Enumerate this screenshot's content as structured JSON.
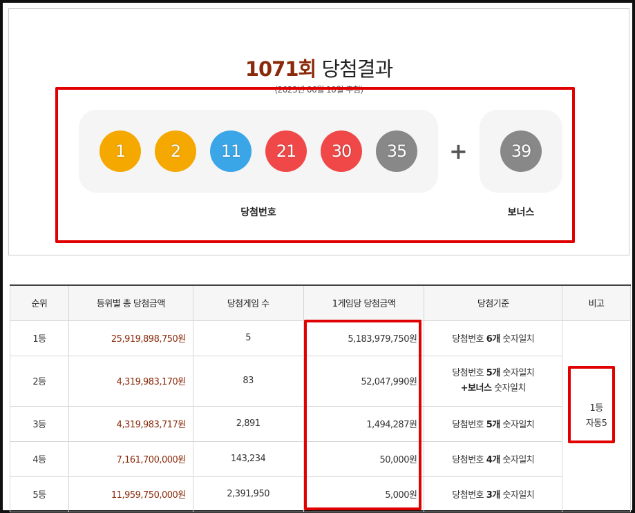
{
  "header": {
    "round": "1071회",
    "title_rest": "당첨결과",
    "draw_date": "(2023년 06월 10일 추첨)"
  },
  "winning_numbers": [
    {
      "number": "1",
      "color": "#f5a800"
    },
    {
      "number": "2",
      "color": "#f5a800"
    },
    {
      "number": "11",
      "color": "#3aa6e8"
    },
    {
      "number": "21",
      "color": "#f04848"
    },
    {
      "number": "30",
      "color": "#f04848"
    },
    {
      "number": "35",
      "color": "#888888"
    }
  ],
  "plus_sign": "+",
  "bonus_number": {
    "number": "39",
    "color": "#888888"
  },
  "labels": {
    "winning": "당첨번호",
    "bonus": "보너스"
  },
  "table": {
    "headers": [
      "순위",
      "등위별 총 당첨금액",
      "당첨게임 수",
      "1게임당 당첨금액",
      "당첨기준",
      "비고"
    ],
    "rows": [
      {
        "rank": "1등",
        "total": "25,919,898,750원",
        "games": "5",
        "per_game": "5,183,979,750원",
        "crit_a": "당첨번호 ",
        "crit_b": "6개",
        "crit_c": " 숫자일치"
      },
      {
        "rank": "2등",
        "total": "4,319,983,170원",
        "games": "83",
        "per_game": "52,047,990원",
        "crit_a": "당첨번호 ",
        "crit_b": "5개",
        "crit_c": " 숫자일치",
        "crit2_a": "+",
        "crit2_b": "보너스",
        "crit2_c": " 숫자일치"
      },
      {
        "rank": "3등",
        "total": "4,319,983,717원",
        "games": "2,891",
        "per_game": "1,494,287원",
        "crit_a": "당첨번호 ",
        "crit_b": "5개",
        "crit_c": " 숫자일치"
      },
      {
        "rank": "4등",
        "total": "7,161,700,000원",
        "games": "143,234",
        "per_game": "50,000원",
        "crit_a": "당첨번호 ",
        "crit_b": "4개",
        "crit_c": " 숫자일치"
      },
      {
        "rank": "5등",
        "total": "11,959,750,000원",
        "games": "2,391,950",
        "per_game": "5,000원",
        "crit_a": "당첨번호 ",
        "crit_b": "3개",
        "crit_c": " 숫자일치"
      }
    ],
    "note_line1": "1등",
    "note_line2": "자동5"
  },
  "colors": {
    "highlight_box": "#e00000",
    "amount_text": "#8a2a0a"
  }
}
